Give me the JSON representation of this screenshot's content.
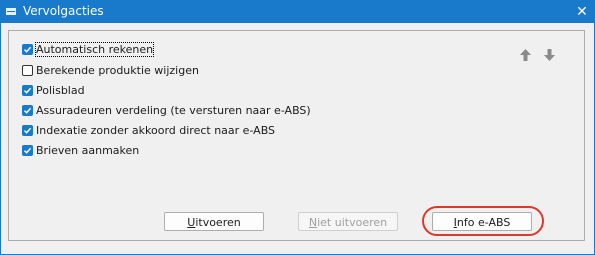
{
  "window": {
    "title": "Vervolgacties"
  },
  "titlebar": {
    "close_glyph": "✕"
  },
  "options": [
    {
      "label": "Automatisch rekenen",
      "checked": true,
      "focused": true
    },
    {
      "label": "Berekende produktie wijzigen",
      "checked": false,
      "focused": false
    },
    {
      "label": "Polisblad",
      "checked": true,
      "focused": false
    },
    {
      "label": "Assuradeuren verdeling (te versturen naar e-ABS)",
      "checked": true,
      "focused": false
    },
    {
      "label": "Indexatie zonder akkoord direct naar e-ABS",
      "checked": true,
      "focused": false
    },
    {
      "label": "Brieven aanmaken",
      "checked": true,
      "focused": false
    }
  ],
  "buttons": {
    "uitvoeren": {
      "mnemonic": "U",
      "rest": "itvoeren",
      "enabled": true
    },
    "niet_uitvoeren": {
      "prefix": "",
      "mnemonic": "N",
      "rest": "iet uitvoeren",
      "enabled": false
    },
    "info_eabs": {
      "mnemonic": "I",
      "rest": "nfo e-ABS",
      "enabled": true,
      "highlighted": true
    }
  },
  "icons": {
    "move_up": "arrow-up-icon",
    "move_down": "arrow-down-icon",
    "app": "app-icon",
    "close": "close-icon"
  },
  "colors": {
    "accent": "#1979ca",
    "highlight_ring": "#d93a2b",
    "disabled_text": "#a0a0a0"
  }
}
